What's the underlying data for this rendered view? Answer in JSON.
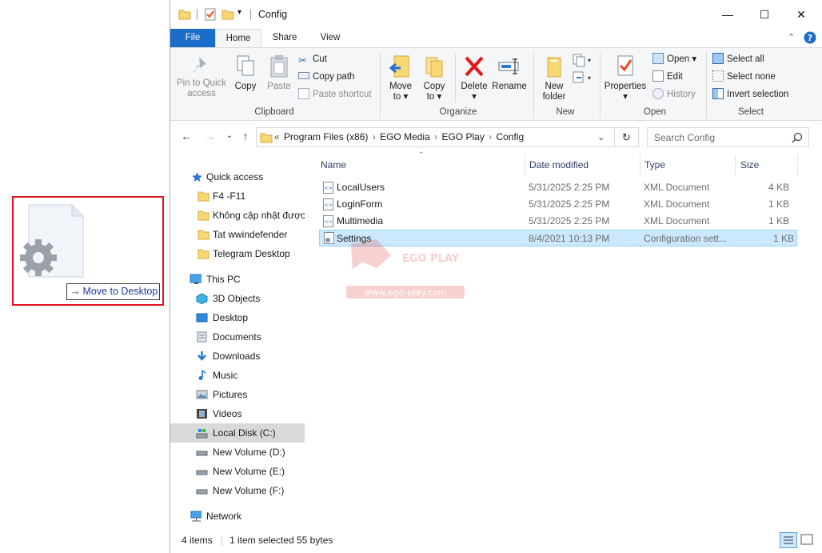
{
  "drag": {
    "label": "Move to Desktop",
    "arrow": "→"
  },
  "window": {
    "title": "Config",
    "controls": {
      "minimize": "—",
      "maximize": "☐",
      "close": "✕"
    }
  },
  "tabs": {
    "file": "File",
    "home": "Home",
    "share": "Share",
    "view": "View"
  },
  "ribbon": {
    "clipboard": {
      "pin": [
        "Pin to Quick",
        "access"
      ],
      "copy": "Copy",
      "paste": "Paste",
      "cut": "Cut",
      "copy_path": "Copy path",
      "paste_shortcut": "Paste shortcut",
      "label": "Clipboard"
    },
    "organize": {
      "move_to": [
        "Move",
        "to ▾"
      ],
      "copy_to": [
        "Copy",
        "to ▾"
      ],
      "delete": [
        "Delete",
        "▾"
      ],
      "rename": "Rename",
      "label": "Organize"
    },
    "new": {
      "new_folder": [
        "New",
        "folder"
      ],
      "label": "New"
    },
    "open": {
      "properties": [
        "Properties",
        "▾"
      ],
      "open": "Open ▾",
      "edit": "Edit",
      "history": "History",
      "label": "Open"
    },
    "select": {
      "select_all": "Select all",
      "select_none": "Select none",
      "invert": "Invert selection",
      "label": "Select"
    }
  },
  "address": {
    "prefix": "«",
    "crumbs": [
      "Program Files (x86)",
      "EGO Media",
      "EGO Play",
      "Config"
    ],
    "separator": "›",
    "search_placeholder": "Search Config"
  },
  "nav": {
    "quick_access": "Quick access",
    "quick_items": [
      "F4 -F11",
      "Không cập nhật được",
      "Tat wwindefender",
      "Telegram Desktop"
    ],
    "this_pc": "This PC",
    "pc_items": [
      "3D Objects",
      "Desktop",
      "Documents",
      "Downloads",
      "Music",
      "Pictures",
      "Videos",
      "Local Disk (C:)",
      "New Volume (D:)",
      "New Volume (E:)",
      "New Volume (F:)"
    ],
    "network": "Network"
  },
  "columns": {
    "name": "Name",
    "date": "Date modified",
    "type": "Type",
    "size": "Size"
  },
  "files": [
    {
      "name": "LocalUsers",
      "date": "5/31/2025 2:25 PM",
      "type": "XML Document",
      "size": "4 KB"
    },
    {
      "name": "LoginForm",
      "date": "5/31/2025 2:25 PM",
      "type": "XML Document",
      "size": "1 KB"
    },
    {
      "name": "Multimedia",
      "date": "5/31/2025 2:25 PM",
      "type": "XML Document",
      "size": "1 KB"
    },
    {
      "name": "Settings",
      "date": "8/4/2021 10:13 PM",
      "type": "Configuration sett...",
      "size": "1 KB"
    }
  ],
  "status": {
    "items": "4 items",
    "selected": "1 item selected",
    "bytes": "55 bytes"
  },
  "watermark": {
    "brand": "EGO PLAY",
    "url": "www.ego-play.com"
  },
  "colors": {
    "accent": "#1a6dc8",
    "selection": "#cce8ff",
    "highlight_box": "#e81123"
  }
}
